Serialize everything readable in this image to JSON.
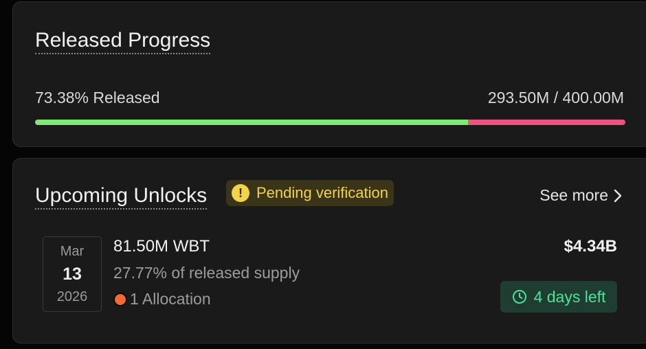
{
  "released_progress": {
    "title": "Released Progress",
    "released_label": "73.38% Released",
    "amount_label": "293.50M / 400.00M",
    "progress_fraction": 0.7338,
    "colors": {
      "released": "#7fe774",
      "locked": "#f0527f"
    }
  },
  "upcoming_unlocks": {
    "title": "Upcoming Unlocks",
    "pending_badge": {
      "icon": "exclamation-icon",
      "text": "Pending verification"
    },
    "see_more": {
      "label": "See more",
      "icon": "chevron-right-icon"
    },
    "unlock": {
      "date": {
        "month": "Mar",
        "day": "13",
        "year": "2026"
      },
      "amount": "81.50M WBT",
      "percent_text": "27.77% of released supply",
      "allocation_text": "1 Allocation",
      "allocation_dot_color": "#f06a33",
      "value": "$4.34B",
      "time_left": {
        "icon": "clock-icon",
        "text": "4 days left"
      }
    }
  }
}
